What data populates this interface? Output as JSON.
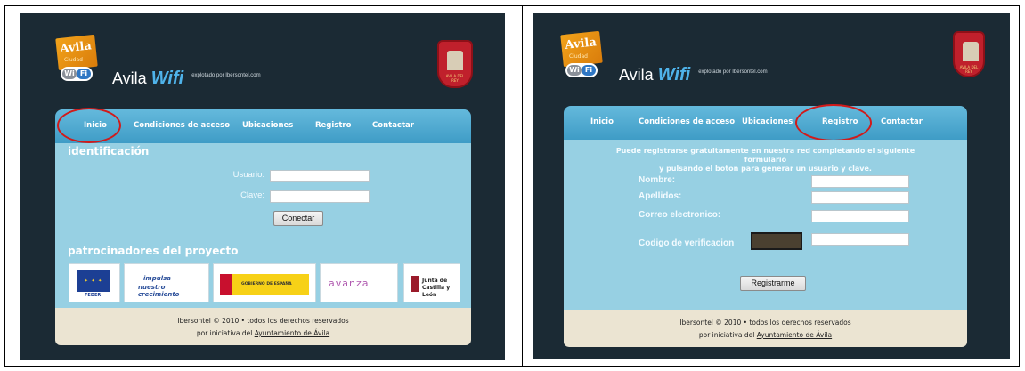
{
  "site": {
    "logo_text": "Avila",
    "logo_sub": "Ciudad",
    "wifi_wi": "Wi",
    "wifi_fi": "Fi",
    "brand_name": "Avila",
    "brand_wifi": "Wifi",
    "brand_sub": "explotado por Ibersontel.com",
    "crest_text": "AVILA DEL REY"
  },
  "nav": {
    "items": [
      "Inicio",
      "Condiciones de acceso",
      "Ubicaciones",
      "Registro",
      "Contactar"
    ]
  },
  "login": {
    "title": "identificación",
    "user_label": "Usuario:",
    "user_value": "",
    "pass_label": "Clave:",
    "pass_value": "",
    "connect_button": "Conectar",
    "sponsors_title": "patrocinadores del proyecto",
    "sponsors": [
      {
        "name": "FEDER",
        "label": "FEDER"
      },
      {
        "name": "impulsa",
        "label_top": "impulsa",
        "label_bottom": "nuestro crecimiento"
      },
      {
        "name": "ministerio",
        "label": "GOBIERNO DE ESPAÑA"
      },
      {
        "name": "avanza",
        "label": "avanza"
      },
      {
        "name": "jcyl",
        "label_top": "Junta de",
        "label_bottom": "Castilla y León"
      }
    ]
  },
  "register": {
    "intro_line1": "Puede registrarse gratuitamente en nuestra red completando el siguiente formulario",
    "intro_line2": "y pulsando el boton para generar un usuario y clave.",
    "nombre_label": "Nombre:",
    "apellidos_label": "Apellidos:",
    "correo_label": "Correo electronico:",
    "codigo_label": "Codigo de verificacion",
    "submit_button": "Registrarme"
  },
  "footer": {
    "line1": "Ibersontel © 2010 • todos los derechos reservados",
    "line2_prefix": "por iniciativa del ",
    "line2_link": "Ayuntamiento de Ávila"
  },
  "colors": {
    "page_bg": "#1b2a34",
    "nav": "#4fa9d2",
    "panel": "#97d0e3",
    "highlight_circle": "#d11a1a"
  }
}
